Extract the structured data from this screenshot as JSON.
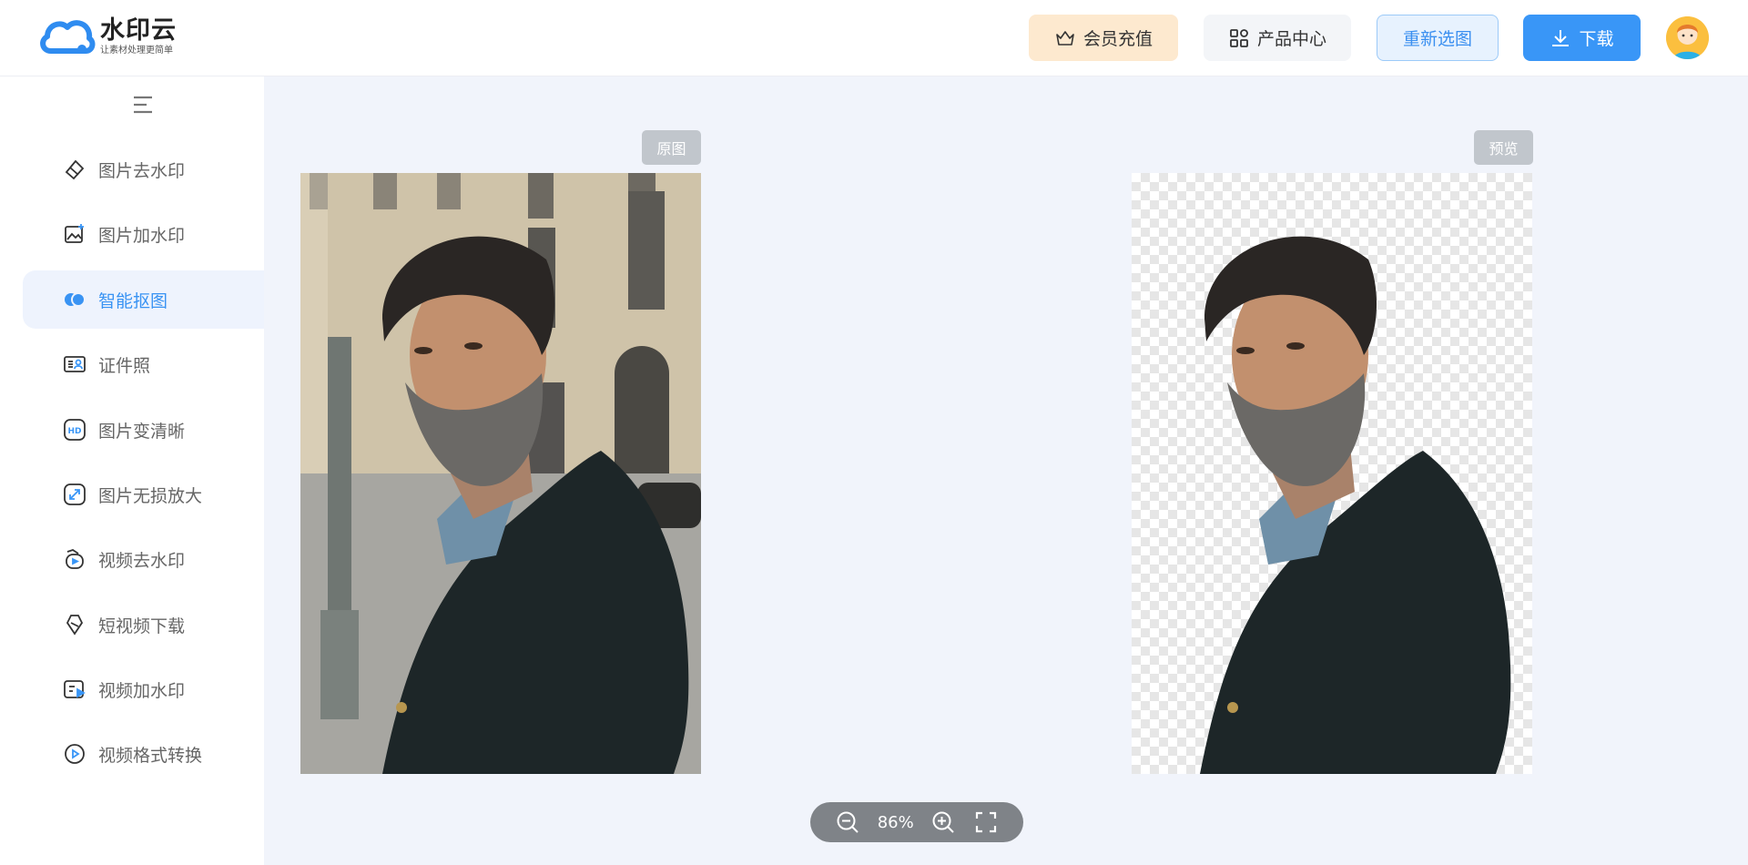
{
  "header": {
    "logo_name": "水印云",
    "logo_slogan": "让素材处理更简单",
    "vip_label": "会员充值",
    "products_label": "产品中心",
    "reselect_label": "重新选图",
    "download_label": "下载"
  },
  "sidebar": {
    "items": [
      {
        "label": "图片去水印",
        "icon": "eraser-icon",
        "active": false
      },
      {
        "label": "图片加水印",
        "icon": "image-add-icon",
        "active": false
      },
      {
        "label": "智能抠图",
        "icon": "cutout-icon",
        "active": true
      },
      {
        "label": "证件照",
        "icon": "id-card-icon",
        "active": false
      },
      {
        "label": "图片变清晰",
        "icon": "hd-icon",
        "active": false
      },
      {
        "label": "图片无损放大",
        "icon": "enlarge-icon",
        "active": false
      },
      {
        "label": "视频去水印",
        "icon": "video-eraser-icon",
        "active": false
      },
      {
        "label": "短视频下载",
        "icon": "link-icon",
        "active": false
      },
      {
        "label": "视频加水印",
        "icon": "video-add-icon",
        "active": false
      },
      {
        "label": "视频格式转换",
        "icon": "play-circle-icon",
        "active": false
      }
    ]
  },
  "canvas": {
    "original_label": "原图",
    "preview_label": "预览"
  },
  "zoom": {
    "level": "86%"
  },
  "colors": {
    "accent": "#3996f7",
    "background": "#f1f4fb",
    "vip_bg": "#fde9cf"
  }
}
